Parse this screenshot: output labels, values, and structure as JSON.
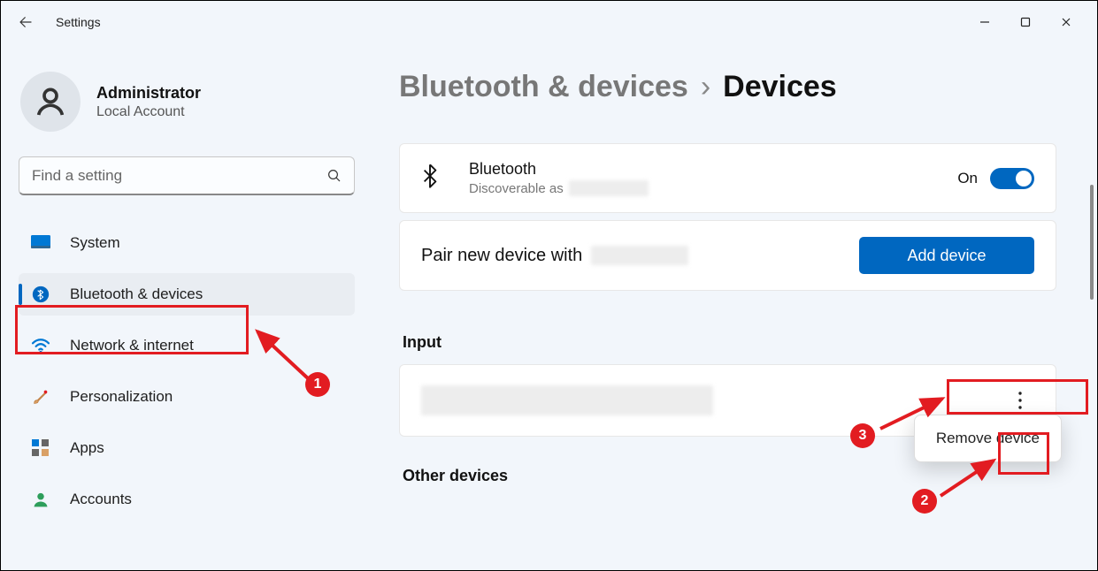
{
  "titlebar": {
    "title": "Settings"
  },
  "user": {
    "name": "Administrator",
    "account_type": "Local Account"
  },
  "search": {
    "placeholder": "Find a setting"
  },
  "nav": {
    "items": [
      {
        "id": "system",
        "label": "System"
      },
      {
        "id": "bluetooth",
        "label": "Bluetooth & devices"
      },
      {
        "id": "network",
        "label": "Network & internet"
      },
      {
        "id": "personalization",
        "label": "Personalization"
      },
      {
        "id": "apps",
        "label": "Apps"
      },
      {
        "id": "accounts",
        "label": "Accounts"
      }
    ],
    "active_index": 1
  },
  "breadcrumb": {
    "parent": "Bluetooth & devices",
    "separator": "›",
    "current": "Devices"
  },
  "bluetooth": {
    "label": "Bluetooth",
    "sub_prefix": "Discoverable as",
    "state_label": "On",
    "state_on": true
  },
  "pair": {
    "text": "Pair new device with",
    "button": "Add device"
  },
  "sections": {
    "input": "Input",
    "other": "Other devices"
  },
  "context_menu": {
    "remove": "Remove device"
  },
  "annotations": {
    "1": "1",
    "2": "2",
    "3": "3"
  }
}
